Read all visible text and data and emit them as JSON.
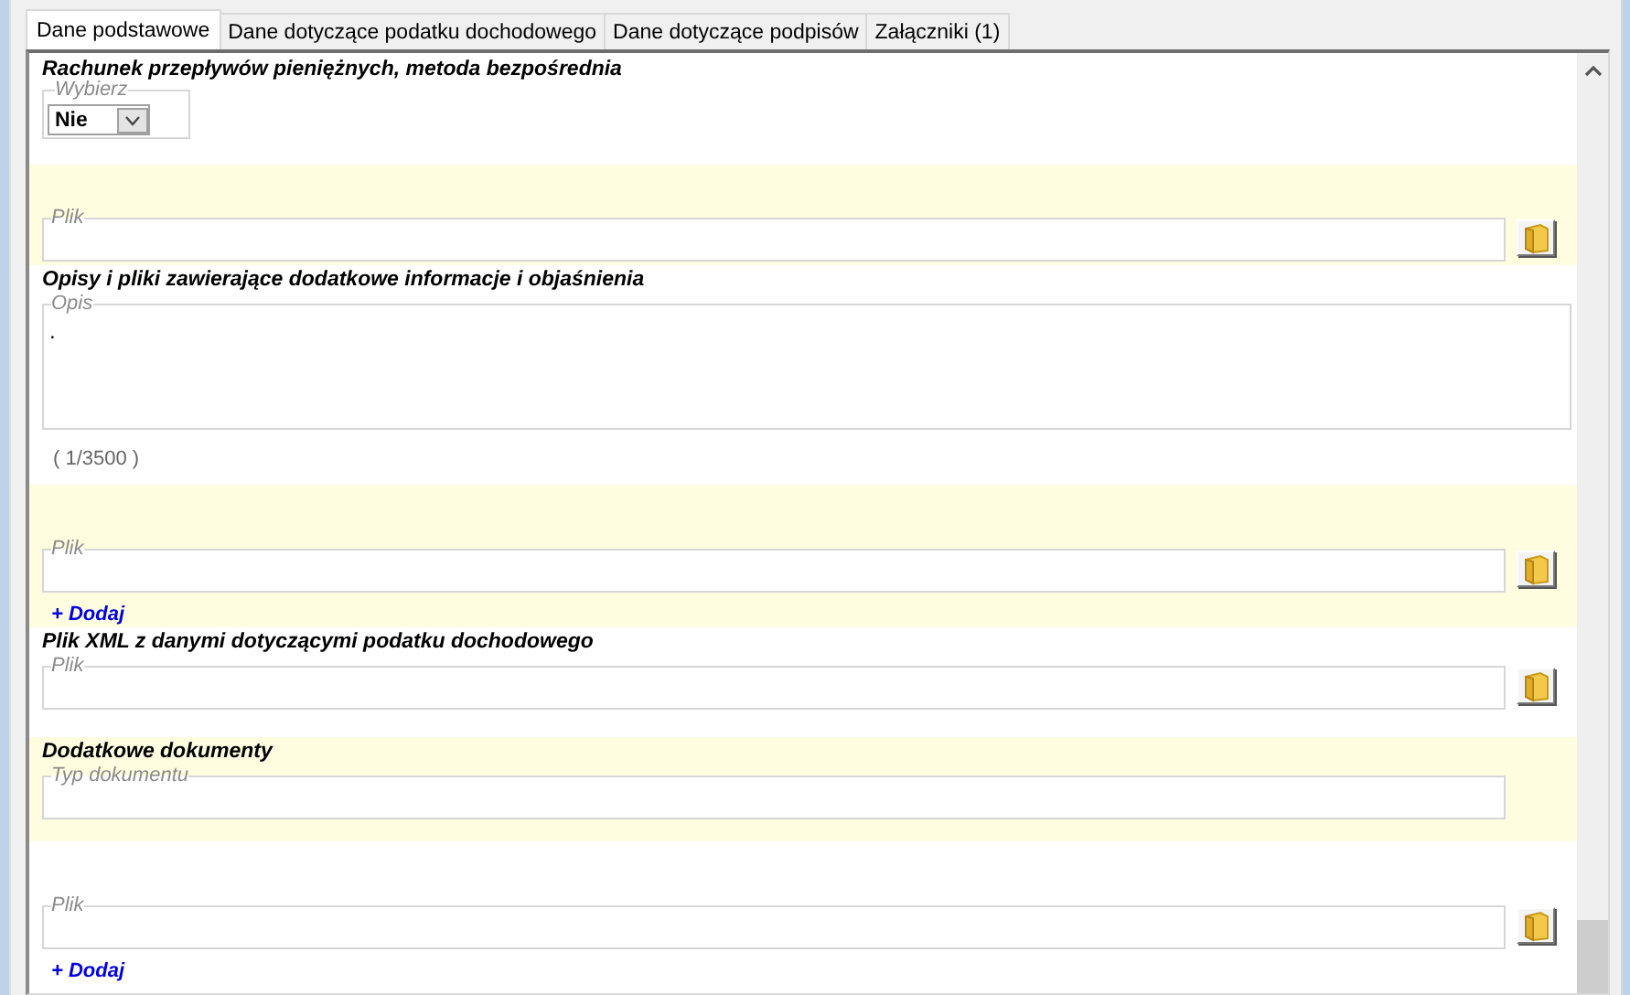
{
  "tabs": [
    {
      "label": "Dane podstawowe",
      "selected": true
    },
    {
      "label": "Dane dotyczące podatku dochodowego",
      "selected": false
    },
    {
      "label": "Dane dotyczące podpisów",
      "selected": false
    },
    {
      "label": "Załączniki (1)",
      "selected": false
    }
  ],
  "sections": [
    {
      "highlight": false,
      "items": [
        {
          "kind": "title",
          "text": "Rachunek przepływów pieniężnych, metoda bezpośrednia"
        },
        {
          "kind": "select",
          "legend": "Wybierz",
          "value": "Nie"
        }
      ]
    },
    {
      "highlight": true,
      "items": [
        {
          "kind": "file",
          "legend": "Plik"
        }
      ]
    },
    {
      "highlight": false,
      "items": [
        {
          "kind": "title",
          "text": "Opisy i pliki zawierające dodatkowe informacje i objaśnienia"
        },
        {
          "kind": "textarea",
          "legend": "Opis",
          "value": "."
        },
        {
          "kind": "counter",
          "text": "( 1/3500 )"
        }
      ]
    },
    {
      "highlight": true,
      "items": [
        {
          "kind": "file",
          "legend": "Plik"
        },
        {
          "kind": "add",
          "text": "+ Dodaj"
        }
      ]
    },
    {
      "highlight": false,
      "items": [
        {
          "kind": "title",
          "text": "Plik XML z danymi dotyczącymi podatku dochodowego"
        },
        {
          "kind": "file",
          "legend": "Plik"
        }
      ]
    },
    {
      "highlight": true,
      "items": [
        {
          "kind": "title",
          "text": "Dodatkowe dokumenty"
        },
        {
          "kind": "text",
          "legend": "Typ dokumentu"
        }
      ]
    },
    {
      "highlight": false,
      "items": [
        {
          "kind": "file",
          "legend": "Plik"
        },
        {
          "kind": "add",
          "text": "+ Dodaj"
        }
      ]
    }
  ]
}
